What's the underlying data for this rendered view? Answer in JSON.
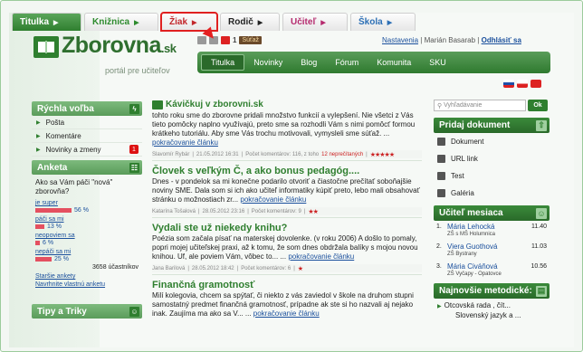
{
  "topTabs": {
    "titulka": "Titulka",
    "kniznica": "Knižnica",
    "ziak": "Žiak",
    "rodic": "Rodič",
    "ucitel": "Učiteľ",
    "skola": "Škola"
  },
  "header": {
    "logo": "Zborovna",
    "logo_suffix": ".sk",
    "subtitle": "portál pre učiteľov",
    "notif_count": "1",
    "sutaz": "Súťaž",
    "nastavenia": "Nastavenia",
    "user": "Marián Basarab",
    "logout": "Odhlásiť sa",
    "separator": "|"
  },
  "mainNav": [
    "Titulka",
    "Novinky",
    "Blog",
    "Fórum",
    "Komunita",
    "SKU"
  ],
  "left": {
    "quickTitle": "Rýchla voľba",
    "quickIconLetter": "z",
    "quickItems": [
      "Pošta",
      "Komentáre",
      "Novinky a zmeny"
    ],
    "novinkyBadge": "1",
    "ankTitle": "Anketa",
    "question": "Ako sa Vám páči \"nová\" zborovňa?",
    "options": [
      {
        "label": "je super",
        "percent": "56 %",
        "value": 56
      },
      {
        "label": "páči sa mi",
        "percent": "13 %",
        "value": 13
      },
      {
        "label": "neopoviem sa",
        "percent": "6 %",
        "value": 6
      },
      {
        "label": "nepáči sa mi",
        "percent": "25 %",
        "value": 25
      }
    ],
    "respondents": "3658 účastníkov",
    "oldPolls": "Staršie ankety",
    "proposePoll": "Navrhnite vlastnú anketu",
    "tipsTitle": "Tipy a Triky"
  },
  "articles": [
    {
      "title": "Kávičkuj v zborovni.sk",
      "body": "tohto roku sme do zborovne pridali množstvo funkcií a vylepšení. Nie všetci z Vás tieto pomôcky naplno využívajú, preto sme sa rozhodli Vám s nimi pomôcť formou krátkeho tutoriálu. Aby sme Vás trochu motivovali, vymysleli sme súťaž.",
      "more": "pokračovanie článku",
      "author": "Slavomír Rybár",
      "date": "21.05.2012 16:31",
      "comments": "Počet komentárov: 116, z toho",
      "unread": "12 neprečítaných",
      "stars": "★★★★★"
    },
    {
      "title": "Človek s veľkým Č, a ako bonus pedagóg....",
      "body": "Dnes - v pondelok sa mi konečne podarilo otvoriť a čiastočne prečítať soboňajšie noviny SME. Dala som si ich ako učiteľ informatiky kúpiť preto, lebo mali obsahovať stránku o možnostiach zr...",
      "more": "pokračovanie článku",
      "author": "Katarína Tošalová",
      "date": "28.05.2012 23:16",
      "comments": "Počet komentárov: 9",
      "stars": "★★"
    },
    {
      "title": "Vydali ste už niekedy knihu?",
      "body": "Poézia som začala písať na materskej dovolenke. (v roku 2006) A došlo to pomaly, popri mojej učiteľskej praxi, až k tomu, že som dnes obdržala balíky s mojou novou knihou. Uf, ale poviem Vám, vôbec to... ...",
      "more": "pokračovanie článku",
      "author": "Jana Barilová",
      "date": "28.05.2012 18:42",
      "comments": "Počet komentárov: 6",
      "stars": "★"
    },
    {
      "title": "Finančná gramotnosť",
      "body": "Milí kolegovia, chcem sa spýtať, či niekto z vás zaviedol v škole na druhom stupni samostatný predmet finančná gramotnosť, prípadne ak ste si ho nazvali aj nejako inak. Zaujíma ma ako sa V... ...",
      "more": "pokračovanie článku"
    }
  ],
  "right": {
    "searchPlaceholder": "Vyhľadávanie",
    "ok": "Ok",
    "addTitle": "Pridaj dokument",
    "addItems": [
      "Dokument",
      "URL link",
      "Test",
      "Galéria"
    ],
    "teacherTitle": "Učiteľ mesiaca",
    "teachers": [
      {
        "n": "1.",
        "name": "Mária Lehocká",
        "school": "ZŠ s MŠ Holumnica",
        "score": "11.40"
      },
      {
        "n": "2.",
        "name": "Viera Guothová",
        "school": "ZŠ Bystrany",
        "score": "11.03"
      },
      {
        "n": "3.",
        "name": "Mária Civáňová",
        "school": "ZŠ Vyčapy - Opatovce",
        "score": "10.56"
      }
    ],
    "methodTitle": "Najnovšie metodické:",
    "methodItems": [
      "Otcovská rada , čít...",
      "Slovenský jazyk a ..."
    ]
  },
  "colors": {
    "green": "#2f7f2f",
    "red": "#c2262a",
    "link": "#1a4f9c"
  }
}
